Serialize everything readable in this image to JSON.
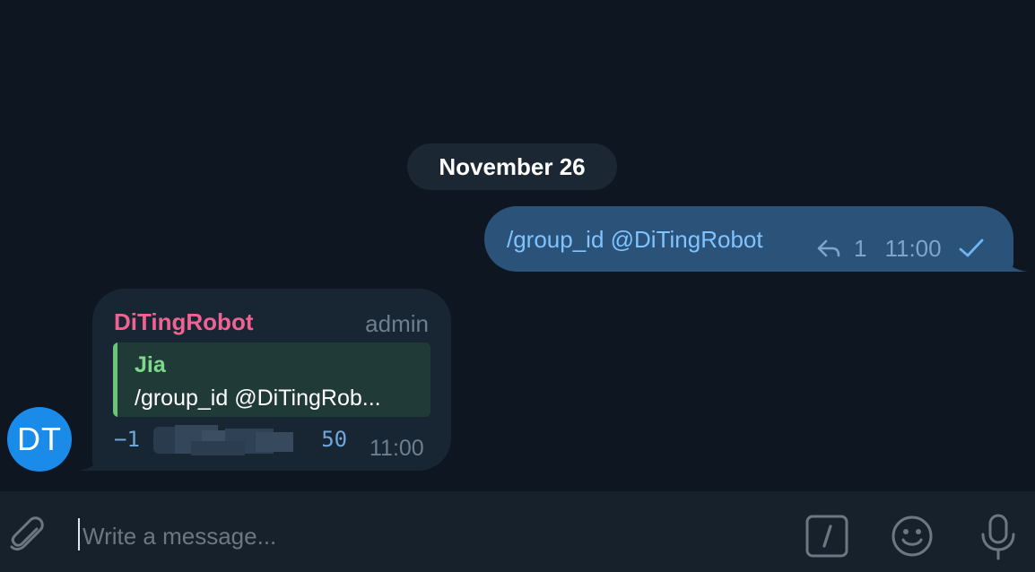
{
  "chat": {
    "date_separator": "November 26",
    "outgoing": {
      "text": "/group_id @DiTingRobot",
      "reply_count": "1",
      "time": "11:00",
      "status_icon": "check-icon"
    },
    "incoming": {
      "sender": "DiTingRobot",
      "role": "admin",
      "quote_author": "Jia",
      "quote_text": "/group_id @DiTingRob...",
      "code_text": "−1              50",
      "time": "11:00",
      "avatar_initials": "DT"
    }
  },
  "composer": {
    "placeholder": "Write a message...",
    "icons": [
      "paperclip-icon",
      "slash-command-icon",
      "emoji-icon",
      "microphone-icon"
    ]
  },
  "colors": {
    "background": "#0e1621",
    "outgoing_bubble": "#2b5278",
    "incoming_bubble": "#182533",
    "sender_name": "#f06292",
    "quote_accent": "#6cc47a",
    "avatar": "#1a8be8"
  }
}
